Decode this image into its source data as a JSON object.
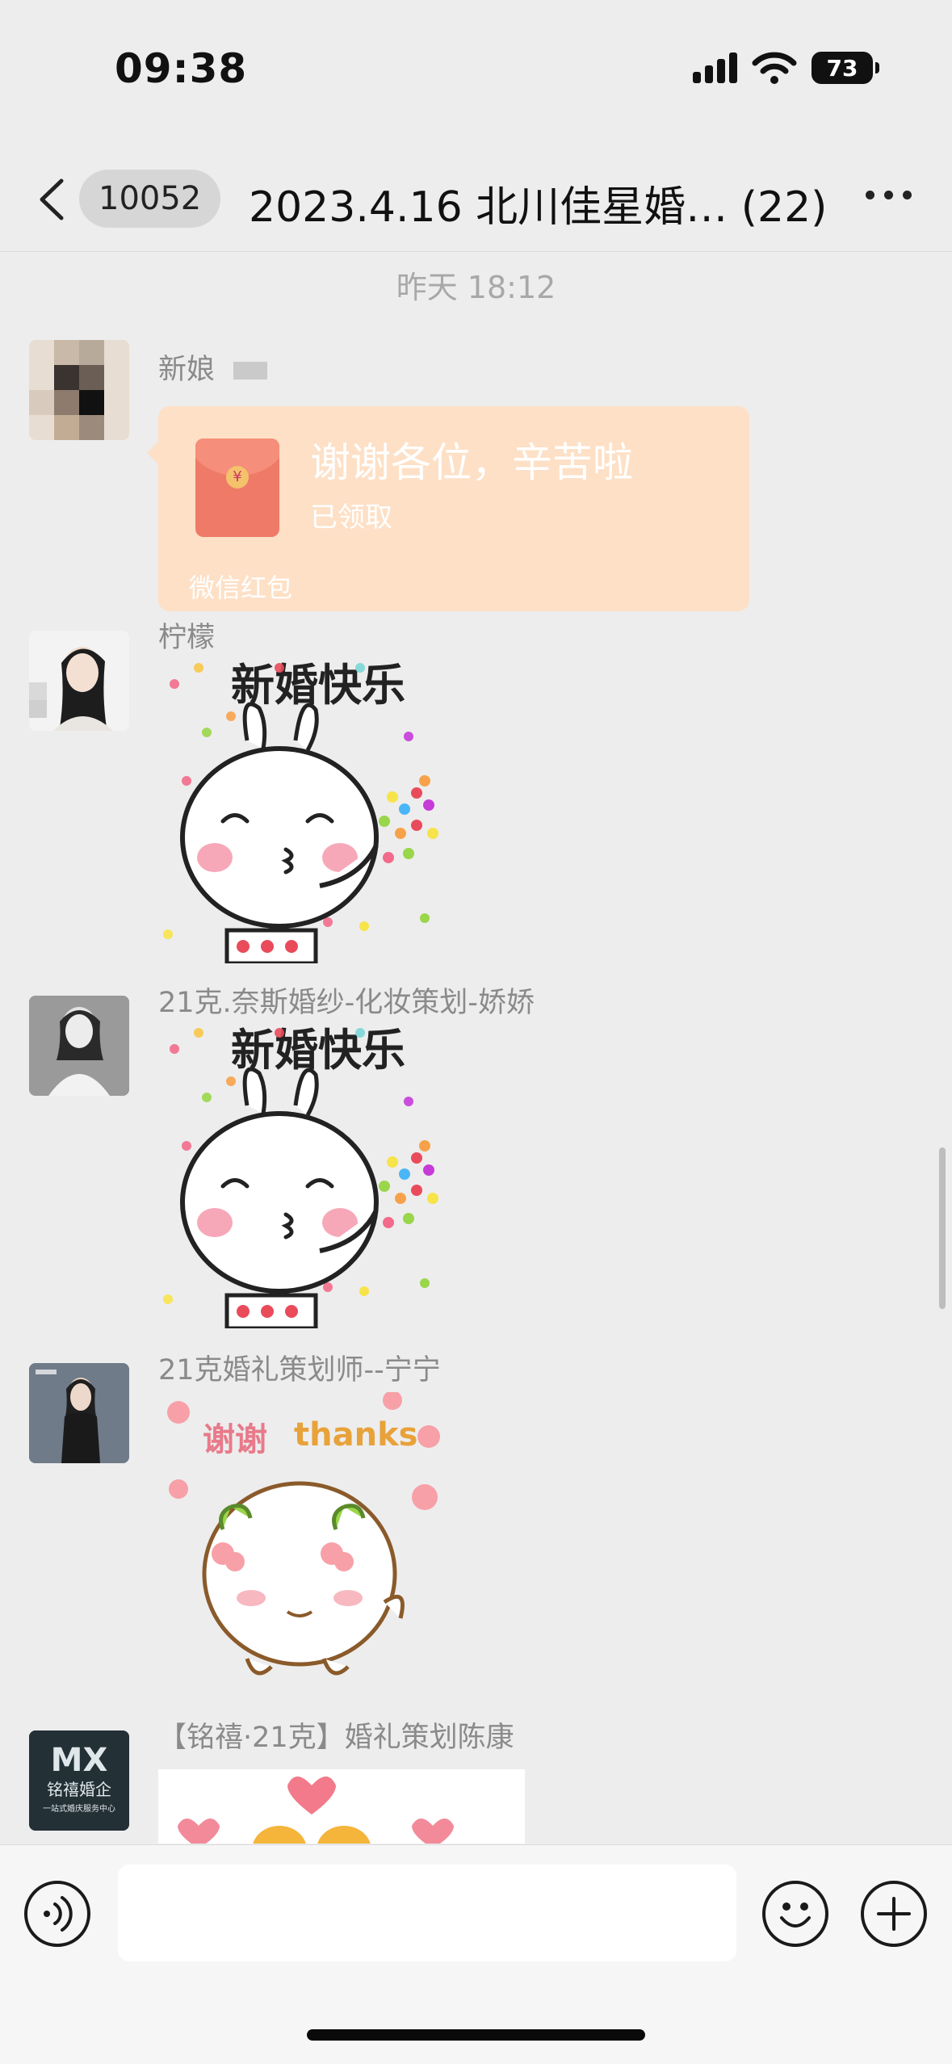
{
  "status_bar": {
    "time": "09:38",
    "battery": "73"
  },
  "header": {
    "unread_count": "10052",
    "title": "2023.4.16 北川佳星婚… (22)"
  },
  "chat": {
    "timestamp": "昨天 18:12",
    "messages": [
      {
        "sender": "新娘",
        "red_packet": {
          "title": "谢谢各位，辛苦啦",
          "status": "已领取",
          "footer": "微信红包"
        }
      },
      {
        "sender": "柠檬",
        "sticker_text": "新婚快乐"
      },
      {
        "sender": "21克.奈斯婚纱-化妆策划-娇娇",
        "sticker_text": "新婚快乐"
      },
      {
        "sender": "21克婚礼策划师--宁宁",
        "sticker_text": {
          "cn": "谢谢",
          "en": "thanks"
        }
      },
      {
        "sender": "【铭禧·21克】婚礼策划陈康",
        "avatar_logo": {
          "mark": "MX",
          "name": "铭禧婚企",
          "tagline": "一站式婚庆服务中心"
        }
      }
    ]
  },
  "input_bar": {
    "text_value": ""
  },
  "colors": {
    "background": "#ededed",
    "red_packet": "#fde0c6",
    "text_muted": "#8a8a8a"
  },
  "icons": [
    "back-icon",
    "more-icon",
    "signal-icon",
    "wifi-icon",
    "battery-icon",
    "voice-icon",
    "emoji-icon",
    "plus-icon"
  ]
}
